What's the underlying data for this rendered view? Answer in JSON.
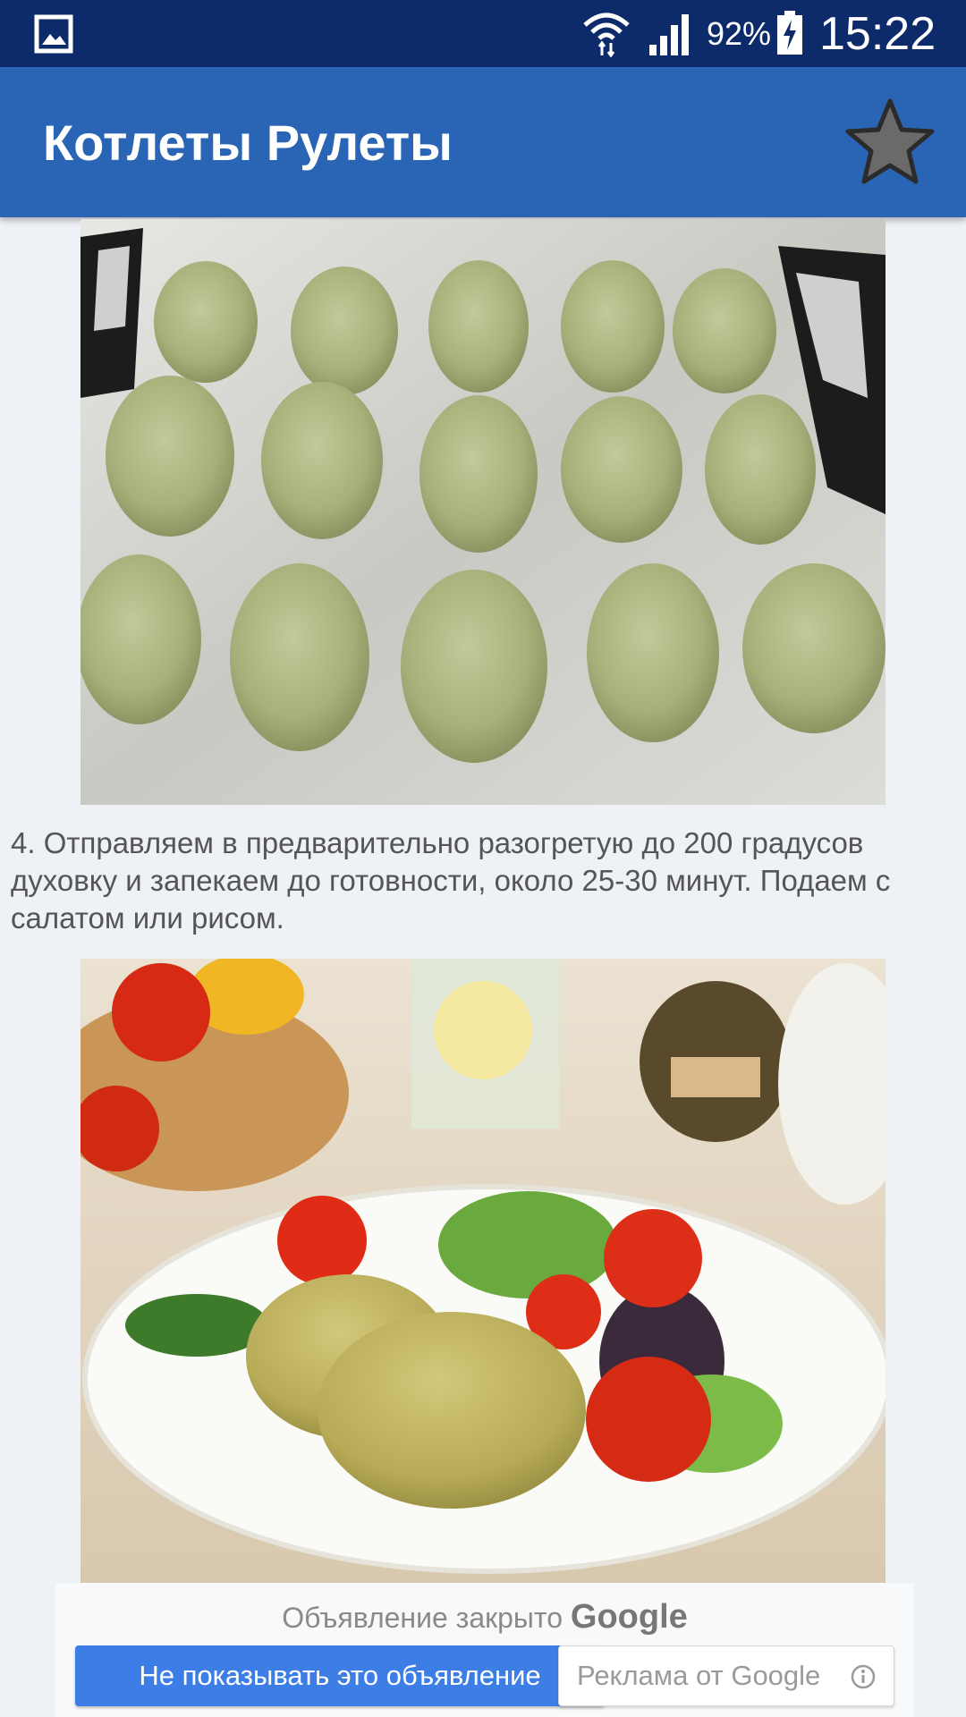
{
  "status_bar": {
    "battery_percent": "92%",
    "time": "15:22",
    "icons": [
      "gallery-icon",
      "wifi-icon",
      "signal-icon",
      "battery-charging-icon"
    ]
  },
  "app_bar": {
    "title": "Котлеты Рулеты",
    "favorite_icon": "star-icon"
  },
  "content": {
    "step_text": "4. Отправляем в предварительно разогретую до 200 градусов духовку и запекаем до готовности, около 25-30 минут. Подаем с салатом или рисом.",
    "images": [
      "raw-cutlets-on-foil-tray",
      "cutlets-with-salad-on-plate"
    ]
  },
  "ad": {
    "closed_text": "Объявление закрыто",
    "google_word": "Google",
    "hide_button_label": "Не показывать это объявление",
    "ads_by_google_label": "Реклама от Google"
  },
  "colors": {
    "status_bar": "#0d2a6b",
    "app_bar": "#2a64b5",
    "accent_button": "#3d7ee6"
  }
}
